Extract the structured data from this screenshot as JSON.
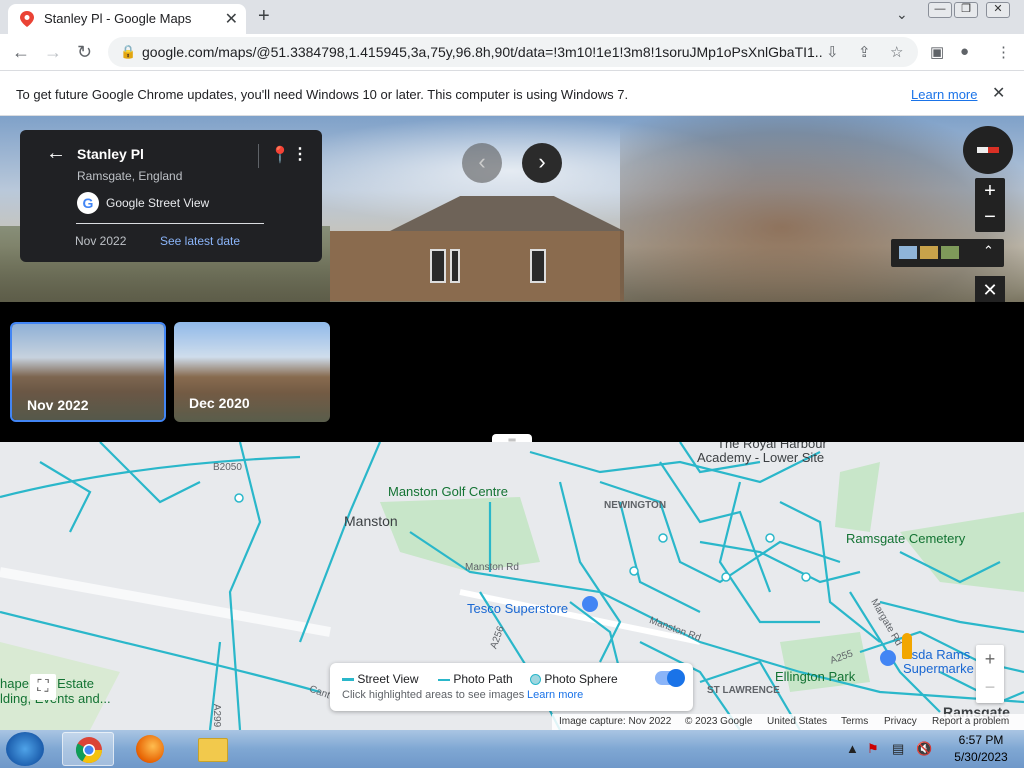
{
  "browser": {
    "tab_title": "Stanley Pl - Google Maps",
    "new_tab": "+",
    "url": "google.com/maps/@51.3384798,1.415945,3a,75y,96.8h,90t/data=!3m10!1e1!3m8!1soruJMp1oPsXnlGbaTI1...",
    "infobar_message": "To get future Google Chrome updates, you'll need Windows 10 or later. This computer is using Windows 7.",
    "infobar_link": "Learn more"
  },
  "streetview": {
    "place": "Stanley Pl",
    "location": "Ramsgate, England",
    "provider": "Google Street View",
    "capture_date": "Nov 2022",
    "latest_link": "See latest date"
  },
  "timeline": [
    {
      "label": "Nov 2022",
      "selected": true
    },
    {
      "label": "Dec 2020",
      "selected": false
    }
  ],
  "map": {
    "labels": {
      "manston": "Manston",
      "golf": "Manston Golf Centre",
      "newington": "NEWINGTON",
      "academy_1": "The Royal Harbour",
      "academy_2": "Academy - Lower Site",
      "cemetery": "Ramsgate Cemetery",
      "tesco": "Tesco Superstore",
      "manston_rd_1": "Manston Rd",
      "manston_rd_2": "Manston Rd",
      "b2050": "B2050",
      "a256": "A256",
      "a255": "A255",
      "a299": "A299",
      "margate_rd": "Margate Rd",
      "st_lawrence": "ST LAWRENCE",
      "ellington": "Ellington Park",
      "asda_1": "Asda Rams",
      "asda_2": "Supermarke",
      "ramsgate": "Ramsgate",
      "estate_1": "hape     use Estate",
      "estate_2": "lding, Events and...",
      "cant": "Cant"
    },
    "legend": {
      "street_view": "Street View",
      "photo_path": "Photo Path",
      "photo_sphere": "Photo Sphere",
      "hint": "Click highlighted areas to see images",
      "learn_more": "Learn more"
    },
    "footer": {
      "capture": "Image capture: Nov 2022",
      "copyright": "© 2023 Google",
      "country": "United States",
      "terms": "Terms",
      "privacy": "Privacy",
      "report": "Report a problem"
    }
  },
  "taskbar": {
    "time": "6:57 PM",
    "date": "5/30/2023"
  },
  "colors": {
    "streetview_lines": "#2ab7ca",
    "accent": "#1a73e8"
  }
}
